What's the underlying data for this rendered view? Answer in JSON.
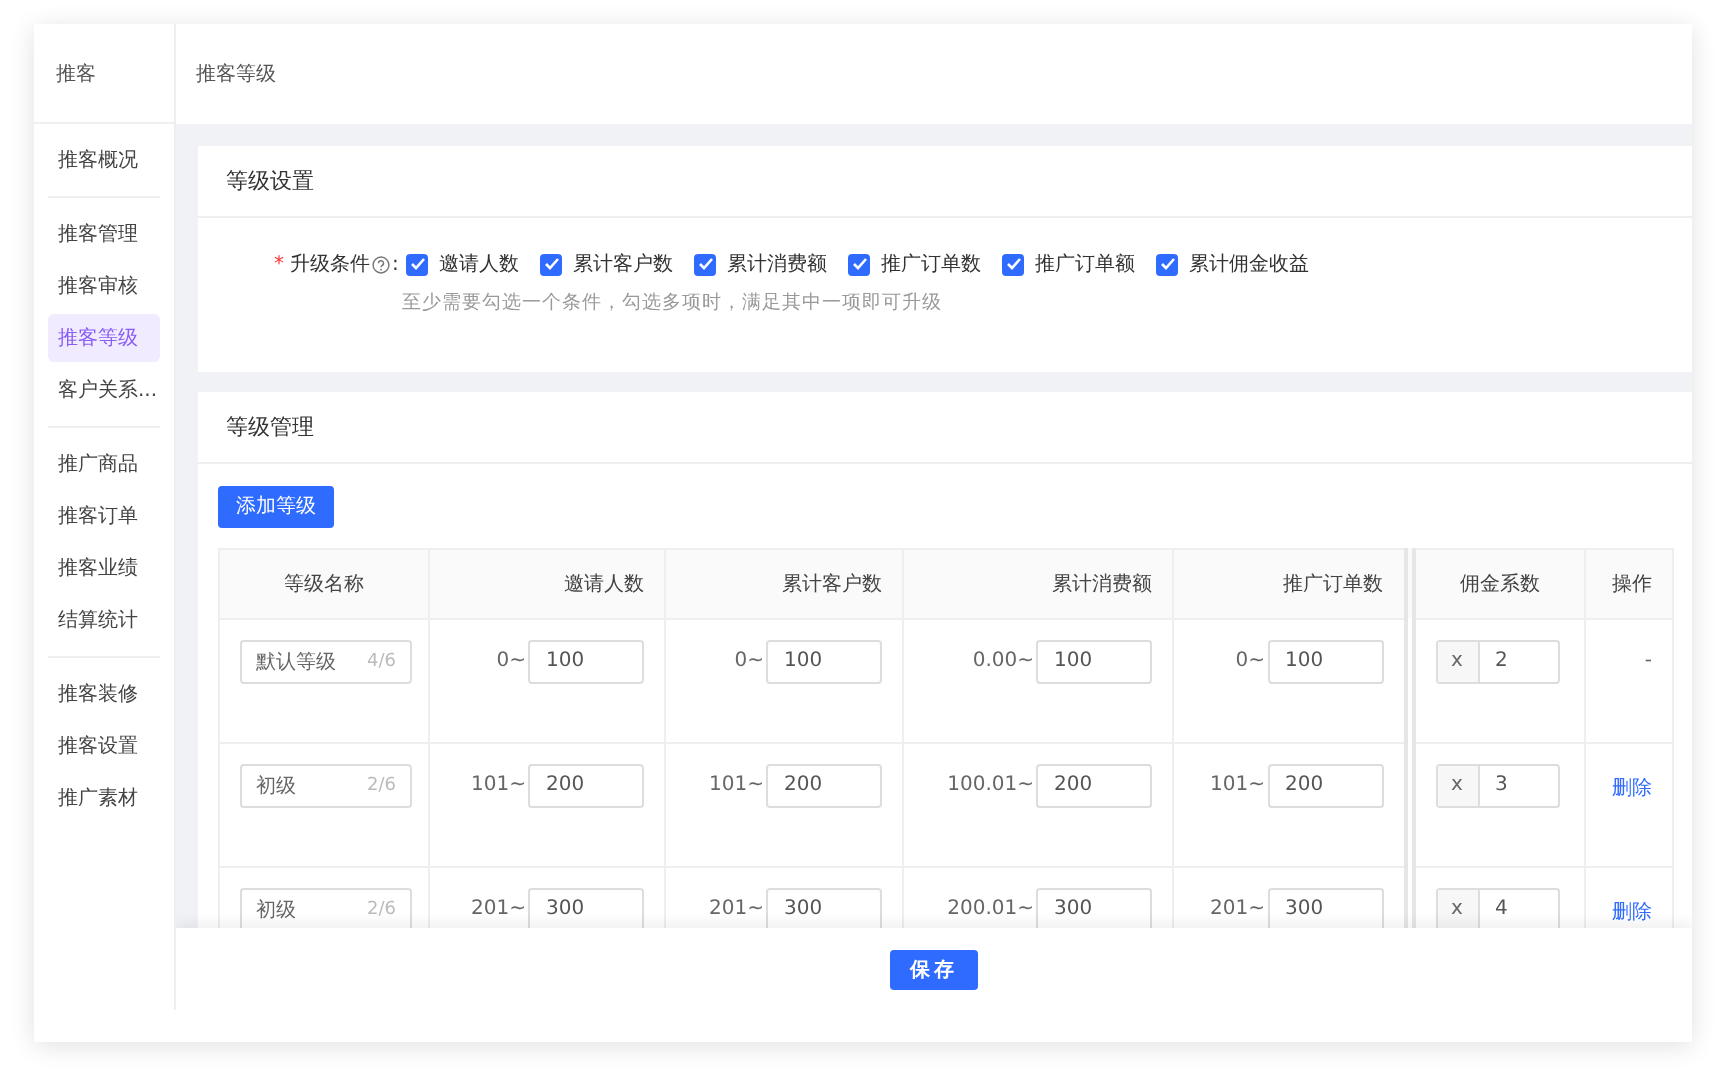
{
  "sidebar": {
    "title": "推客",
    "groups": [
      {
        "items": [
          {
            "label": "推客概况",
            "selected": false
          }
        ]
      },
      {
        "items": [
          {
            "label": "推客管理",
            "selected": false
          },
          {
            "label": "推客审核",
            "selected": false
          },
          {
            "label": "推客等级",
            "selected": true
          },
          {
            "label": "客户关系...",
            "selected": false
          }
        ]
      },
      {
        "items": [
          {
            "label": "推广商品",
            "selected": false
          },
          {
            "label": "推客订单",
            "selected": false
          },
          {
            "label": "推客业绩",
            "selected": false
          },
          {
            "label": "结算统计",
            "selected": false
          }
        ]
      },
      {
        "items": [
          {
            "label": "推客装修",
            "selected": false
          },
          {
            "label": "推客设置",
            "selected": false
          },
          {
            "label": "推广素材",
            "selected": false
          }
        ]
      }
    ]
  },
  "breadcrumb": "推客等级",
  "level_settings": {
    "title": "等级设置",
    "condition": {
      "required_mark": "*",
      "label": "升级条件",
      "colon": ":",
      "options": [
        {
          "label": "邀请人数",
          "checked": true
        },
        {
          "label": "累计客户数",
          "checked": true
        },
        {
          "label": "累计消费额",
          "checked": true
        },
        {
          "label": "推广订单数",
          "checked": true
        },
        {
          "label": "推广订单额",
          "checked": true
        },
        {
          "label": "累计佣金收益",
          "checked": true
        }
      ],
      "hint": "至少需要勾选一个条件，勾选多项时，满足其中一项即可升级"
    }
  },
  "level_management": {
    "title": "等级管理",
    "add_button": "添加等级",
    "table": {
      "columns": [
        "等级名称",
        "邀请人数",
        "累计客户数",
        "累计消费额",
        "推广订单数",
        "佣金系数",
        "操作"
      ],
      "rows": [
        {
          "name": "默认等级",
          "counter": "4/6",
          "ranges": [
            {
              "prefix": "0~",
              "value": "100"
            },
            {
              "prefix": "0~",
              "value": "100"
            },
            {
              "prefix": "0.00~",
              "value": "100"
            },
            {
              "prefix": "0~",
              "value": "100"
            }
          ],
          "coefficient": {
            "prefix": "x",
            "value": "2"
          },
          "action": {
            "kind": "text",
            "label": "-"
          }
        },
        {
          "name": "初级",
          "counter": "2/6",
          "ranges": [
            {
              "prefix": "101~",
              "value": "200"
            },
            {
              "prefix": "101~",
              "value": "200"
            },
            {
              "prefix": "100.01~",
              "value": "200"
            },
            {
              "prefix": "101~",
              "value": "200"
            }
          ],
          "coefficient": {
            "prefix": "x",
            "value": "3"
          },
          "action": {
            "kind": "link",
            "label": "删除"
          }
        },
        {
          "name": "初级",
          "counter": "2/6",
          "ranges": [
            {
              "prefix": "201~",
              "value": "300"
            },
            {
              "prefix": "201~",
              "value": "300"
            },
            {
              "prefix": "200.01~",
              "value": "300"
            },
            {
              "prefix": "201~",
              "value": "300"
            }
          ],
          "coefficient": {
            "prefix": "x",
            "value": "4"
          },
          "action": {
            "kind": "link",
            "label": "删除"
          }
        }
      ]
    }
  },
  "save_button": "保存"
}
